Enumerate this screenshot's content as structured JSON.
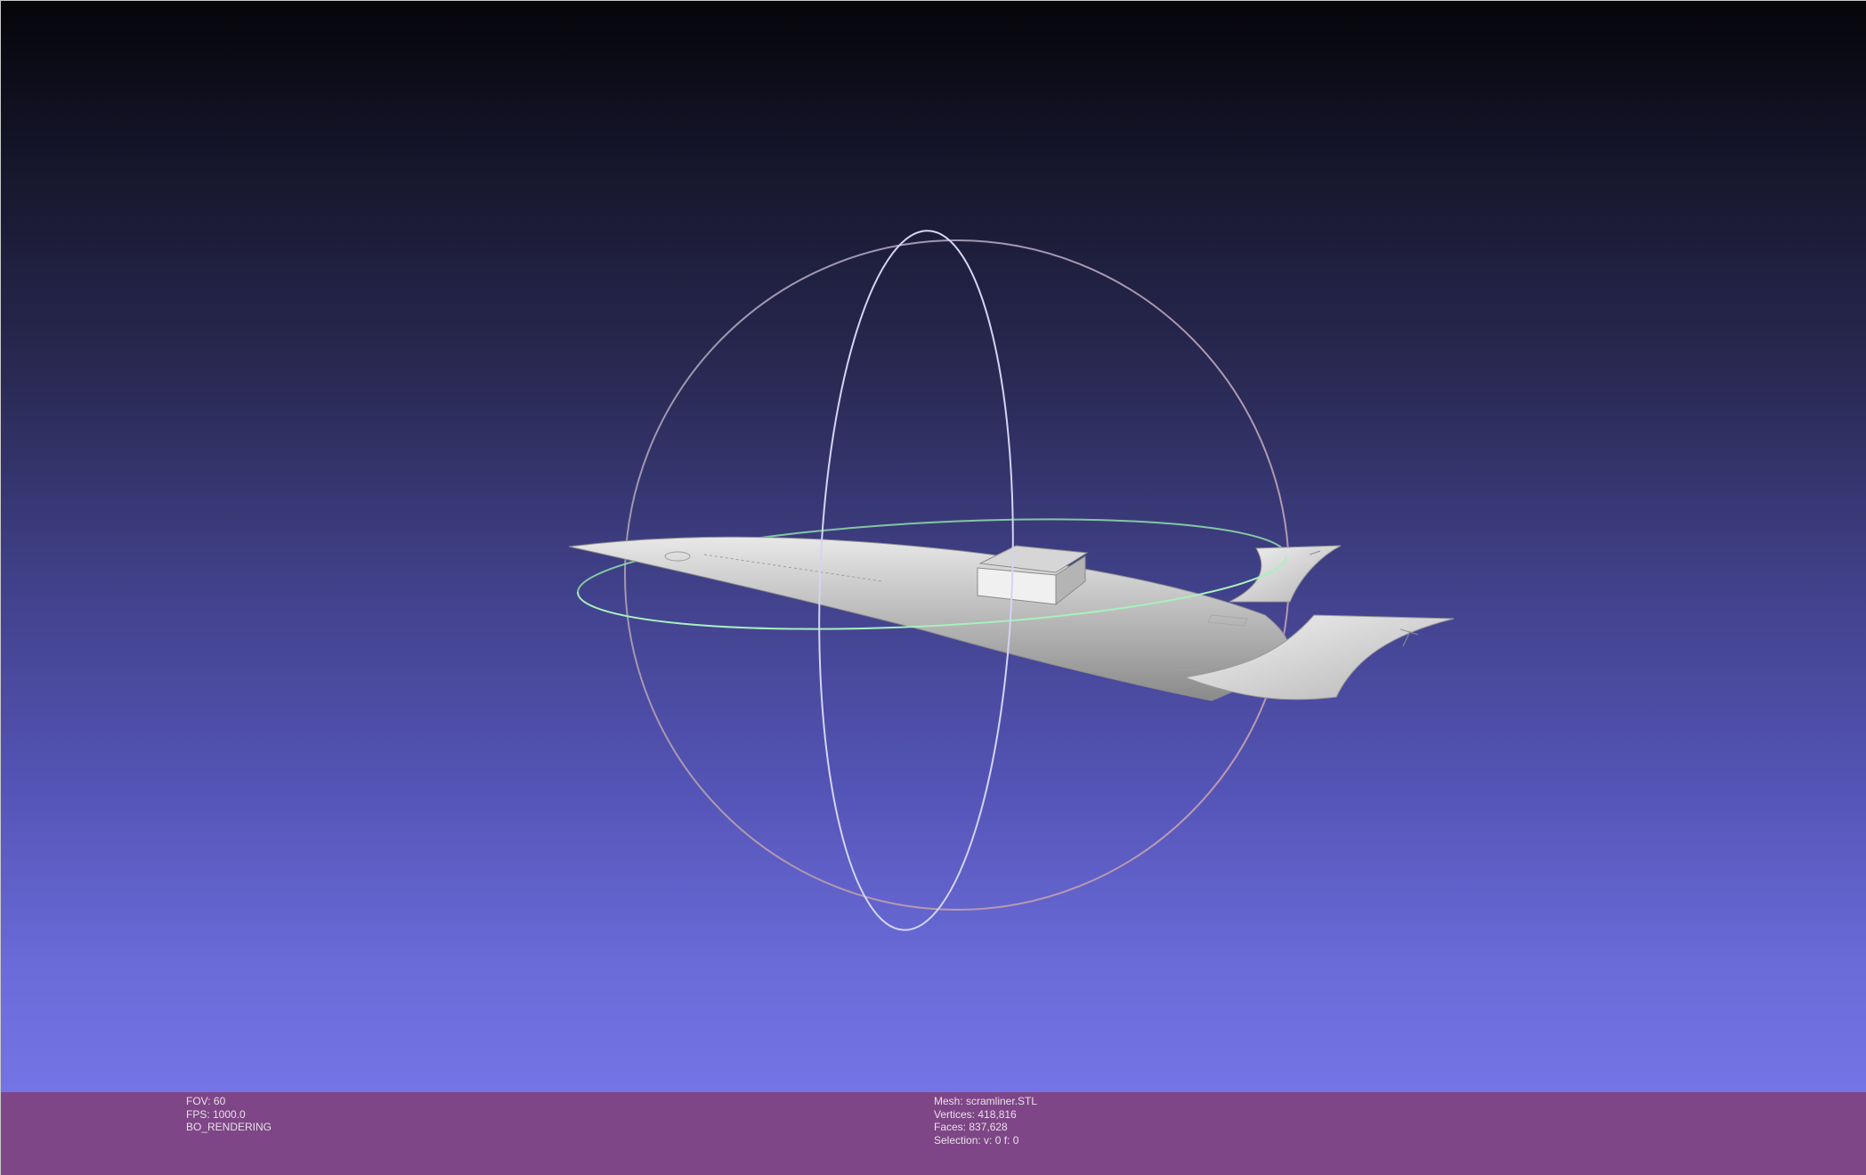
{
  "status": {
    "fov": "FOV: 60",
    "fps": "FPS:  1000.0",
    "render_mode": "BO_RENDERING",
    "mesh": "Mesh: scramliner.STL",
    "vertices": "Vertices: 418,816",
    "faces": "Faces: 837,628",
    "selection": "Selection: v: 0 f: 0"
  },
  "colors": {
    "statusbar_bg": "#7e4686",
    "trackball_vertical": "#c8c8ee",
    "trackball_horizontal": "#8fe0a8",
    "trackball_outer": "#9a8fa8",
    "mesh_surface": "#cfcfcf"
  },
  "icons": {
    "trackball": "trackball-gizmo",
    "mesh": "scramjet-aircraft-mesh"
  }
}
